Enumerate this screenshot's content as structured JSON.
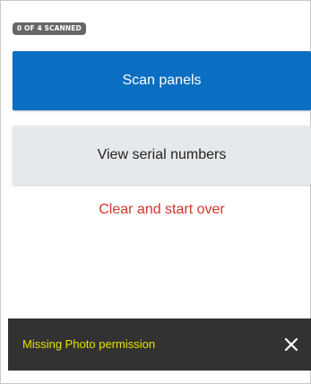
{
  "status": {
    "badge": "0 OF 4 SCANNED"
  },
  "actions": {
    "scan_label": "Scan panels",
    "view_label": "View serial numbers",
    "clear_label": "Clear and start over"
  },
  "snackbar": {
    "message": "Missing Photo permission",
    "dismiss_icon": "close-icon"
  },
  "colors": {
    "primary": "#0a6fc2",
    "secondary_bg": "#e6e9ec",
    "danger_text": "#d0362a",
    "snackbar_bg": "#323232",
    "snackbar_text": "#e5e100",
    "badge_bg": "#666666"
  }
}
